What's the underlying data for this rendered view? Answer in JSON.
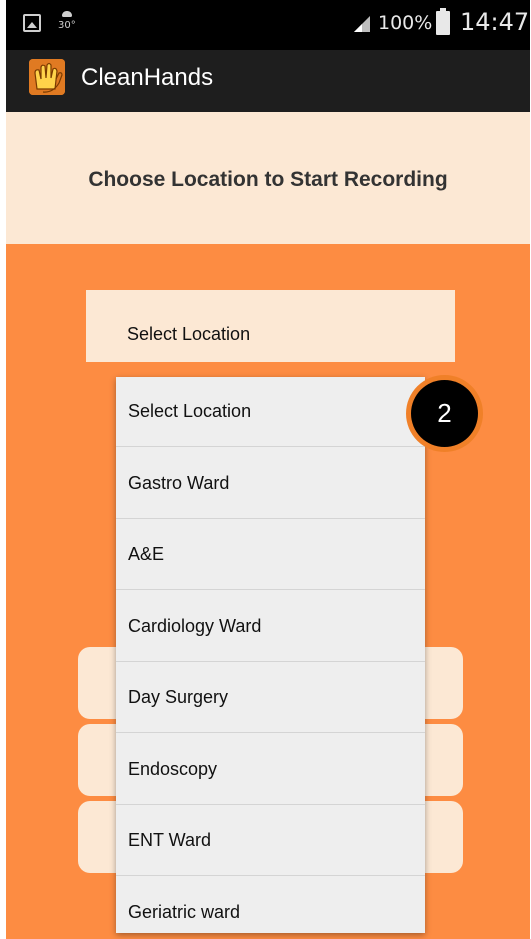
{
  "status_bar": {
    "weather_temp": "30°",
    "battery_percent": "100%",
    "time": "14:47",
    "icons": [
      "gallery-icon",
      "weather-icon",
      "signal-icon",
      "battery-icon"
    ]
  },
  "app_bar": {
    "title": "CleanHands",
    "logo_icon": "clapping-hands-icon"
  },
  "header": {
    "title": "Choose Location to Start Recording"
  },
  "spinner": {
    "selected": "Select Location"
  },
  "dropdown": {
    "options": [
      "Select Location",
      "Gastro Ward",
      "A&E",
      "Cardiology Ward",
      "Day Surgery",
      "Endoscopy",
      "ENT Ward",
      "Geriatric ward"
    ]
  },
  "badge": {
    "step": "2"
  },
  "colors": {
    "background": "#FD8C42",
    "panel": "#FCE8D4",
    "actionbar": "#1e1e1e",
    "badge_ring": "#F08028"
  }
}
